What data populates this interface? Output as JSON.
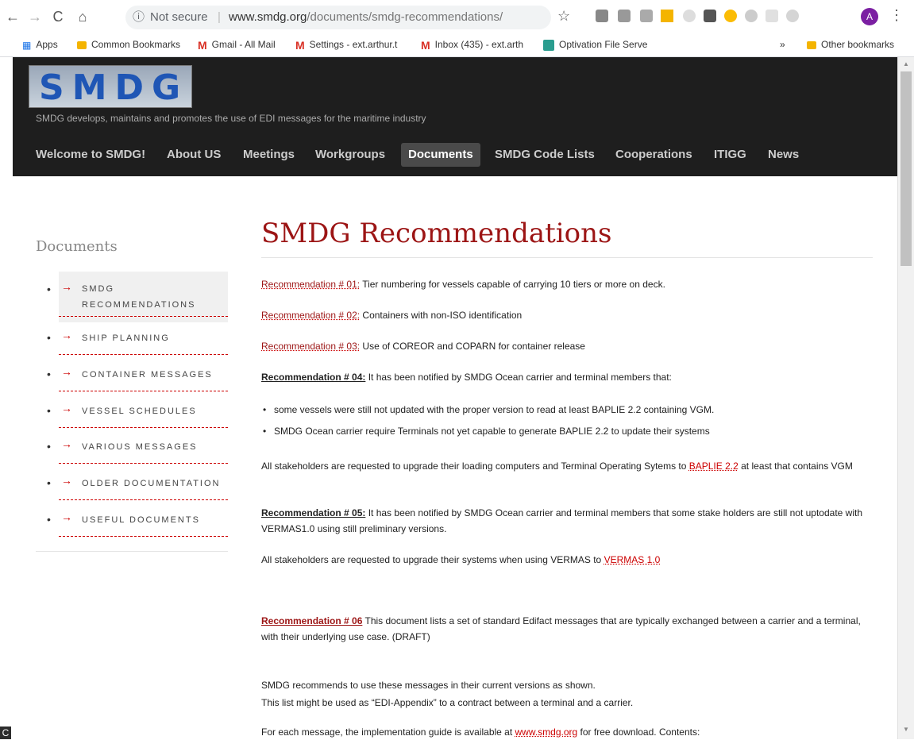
{
  "browser": {
    "url_info_icon": "ⓘ",
    "not_secure": "Not secure",
    "separator": "|",
    "url_domain": "www.smdg.org",
    "url_path": "/documents/smdg-recommendations/",
    "profile_initial": "A",
    "icons": [
      "back-arrow-icon",
      "forward-arrow-icon",
      "reload-icon",
      "home-icon",
      "star-icon",
      "menu-dots-icon"
    ],
    "bookmarks": {
      "apps": "Apps",
      "common": "Common Bookmarks",
      "gmail": "Gmail - All Mail",
      "settings": "Settings - ext.arthur.t",
      "inbox": "Inbox (435) - ext.arth",
      "optivation": "Optivation File Serve",
      "overflow": "»",
      "other": "Other bookmarks"
    }
  },
  "site": {
    "logo_text": "SMDG",
    "tagline": "SMDG develops, maintains and promotes the use of EDI messages for the maritime industry",
    "nav": [
      "Welcome to SMDG!",
      "About US",
      "Meetings",
      "Workgroups",
      "Documents",
      "SMDG Code Lists",
      "Cooperations",
      "ITIGG",
      "News"
    ],
    "active_nav": "Documents"
  },
  "sidebar": {
    "title": "Documents",
    "items": [
      {
        "label": "SMDG RECOMMENDATIONS"
      },
      {
        "label": "SHIP PLANNING"
      },
      {
        "label": "CONTAINER MESSAGES"
      },
      {
        "label": "VESSEL SCHEDULES"
      },
      {
        "label": "VARIOUS MESSAGES"
      },
      {
        "label": "OLDER DOCUMENTATION"
      },
      {
        "label": "USEFUL DOCUMENTS"
      }
    ]
  },
  "content": {
    "title": "SMDG Recommendations",
    "rec1_link": "Recommendation # 01:",
    "rec1_text": " Tier numbering for vessels capable of carrying 10 tiers or more on deck.",
    "rec2_link": "Recommendation # 02:",
    "rec2_text": " Containers with non-ISO identification",
    "rec3_link": "Recommendation # 03:",
    "rec3_text": " Use of COREOR and COPARN for container release",
    "rec4_label": "Recommendation # 04:",
    "rec4_text": " It has been notified by SMDG Ocean carrier and terminal members that:",
    "rec4_bullet1": "some vessels were still not updated with the proper version to read at least BAPLIE 2.2 containing VGM.",
    "rec4_bullet2": "SMDG Ocean carrier require Terminals not yet capable to generate BAPLIE 2.2 to update their systems",
    "rec4_request_a": "All stakeholders are requested to upgrade their loading computers and Terminal Operating Sytems to ",
    "rec4_link": "BAPLIE 2.2",
    "rec4_request_b": " at least that contains VGM",
    "rec5_label": "Recommendation # 05:",
    "rec5_text": " It has been notified by SMDG Ocean carrier and terminal members that some stake holders are still not uptodate with VERMAS1.0 using still preliminary versions.",
    "rec5_request": "All stakeholders are requested to upgrade their systems when using VERMAS to ",
    "rec5_link": "VERMAS 1.0",
    "rec6_label": "Recommendation # 06",
    "rec6_text": " This document lists a set of standard Edifact messages that are typically exchanged between a carrier and a terminal, with their underlying use case. (DRAFT)",
    "recommend_line1": "SMDG recommends to use these messages in their current versions as shown.",
    "recommend_line2": "This list might be used as “EDI-Appendix” to a contract between a terminal and a carrier.",
    "impl_a": "For each message, the implementation guide is available at ",
    "impl_link": "www.smdg.org",
    "impl_b": " for free download. Contents:"
  },
  "colors": {
    "accent": "#9c1515",
    "link": "#cc0000",
    "header_bg": "#1e1e1e"
  }
}
